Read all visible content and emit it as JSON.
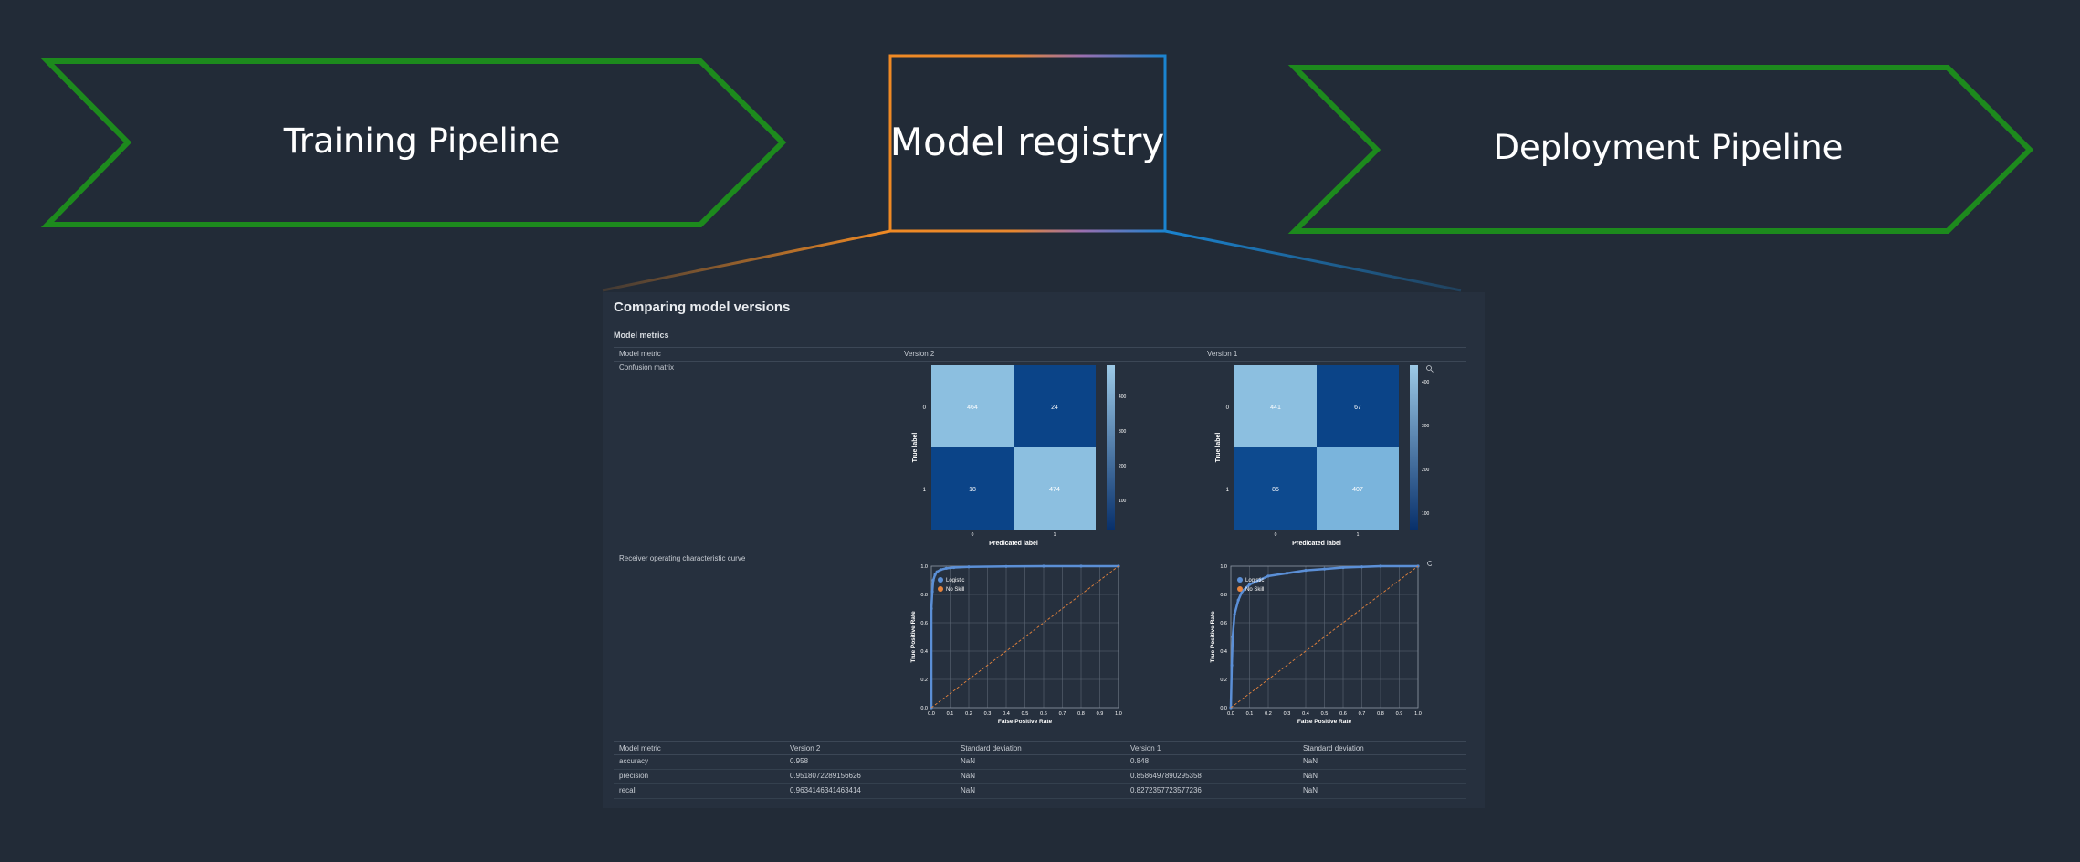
{
  "stages": {
    "training": "Training Pipeline",
    "registry": "Model registry",
    "deployment": "Deployment Pipeline"
  },
  "colors": {
    "background": "#222b37",
    "chevron_stroke": "#1d8a1d",
    "registry_orange": "#f08a24",
    "registry_blue": "#1a84d0",
    "panel": "#26303e",
    "cm_light": "#8cbfe0",
    "cm_dark": "#0b4488",
    "roc_curve": "#5b8fd6",
    "noskill": "#e8843c"
  },
  "panel": {
    "title": "Comparing model versions",
    "section": "Model metrics",
    "headers": [
      "Model metric",
      "Version 2",
      "Version 1"
    ],
    "rows": {
      "confusion": "Confusion matrix",
      "roc": "Receiver operating characteristic curve"
    }
  },
  "confusion_matrices": [
    {
      "version": "Version 2",
      "cells": [
        [
          464,
          24
        ],
        [
          18,
          474
        ]
      ],
      "colorbar_ticks": [
        "400",
        "300",
        "200",
        "100"
      ],
      "ylabel": "True label",
      "xlabel": "Predicated label",
      "row_ticks": [
        "0",
        "1"
      ],
      "col_ticks": [
        "0",
        "1"
      ]
    },
    {
      "version": "Version 1",
      "cells": [
        [
          441,
          67
        ],
        [
          85,
          407
        ]
      ],
      "colorbar_ticks": [
        "400",
        "300",
        "200",
        "100"
      ],
      "ylabel": "True label",
      "xlabel": "Predicated label",
      "row_ticks": [
        "0",
        "1"
      ],
      "col_ticks": [
        "0",
        "1"
      ]
    }
  ],
  "roc": {
    "legend": [
      "Logistic",
      "No Skill"
    ],
    "xlabel": "False Positive Rate",
    "ylabel": "True Positive Rate",
    "x_ticks": [
      "0.0",
      "0.1",
      "0.2",
      "0.3",
      "0.4",
      "0.5",
      "0.6",
      "0.7",
      "0.8",
      "0.9",
      "1.0"
    ],
    "y_ticks": [
      "0.0",
      "0.2",
      "0.4",
      "0.6",
      "0.8",
      "1.0"
    ]
  },
  "chart_data": [
    {
      "type": "line",
      "name": "ROC Version 2",
      "xlabel": "False Positive Rate",
      "ylabel": "True Positive Rate",
      "xlim": [
        0,
        1
      ],
      "ylim": [
        0,
        1
      ],
      "series": [
        {
          "name": "Logistic",
          "x": [
            0,
            0.0,
            0.005,
            0.01,
            0.02,
            0.03,
            0.05,
            0.08,
            0.12,
            0.2,
            0.4,
            0.6,
            0.8,
            1.0
          ],
          "y": [
            0,
            0.7,
            0.82,
            0.9,
            0.94,
            0.96,
            0.975,
            0.985,
            0.99,
            0.995,
            0.998,
            1.0,
            1.0,
            1.0
          ]
        },
        {
          "name": "No Skill",
          "x": [
            0,
            1
          ],
          "y": [
            0,
            1
          ]
        }
      ]
    },
    {
      "type": "line",
      "name": "ROC Version 1",
      "xlabel": "False Positive Rate",
      "ylabel": "True Positive Rate",
      "xlim": [
        0,
        1
      ],
      "ylim": [
        0,
        1
      ],
      "series": [
        {
          "name": "Logistic",
          "x": [
            0,
            0.005,
            0.01,
            0.02,
            0.04,
            0.06,
            0.1,
            0.15,
            0.2,
            0.3,
            0.4,
            0.5,
            0.6,
            0.7,
            0.8,
            1.0
          ],
          "y": [
            0,
            0.3,
            0.5,
            0.66,
            0.76,
            0.82,
            0.87,
            0.9,
            0.93,
            0.95,
            0.97,
            0.98,
            0.99,
            0.995,
            1.0,
            1.0
          ]
        },
        {
          "name": "No Skill",
          "x": [
            0,
            1
          ],
          "y": [
            0,
            1
          ]
        }
      ]
    }
  ],
  "metrics_table": {
    "headers": [
      "Model metric",
      "Version 2",
      "Standard deviation",
      "Version 1",
      "Standard deviation"
    ],
    "rows": [
      [
        "accuracy",
        "0.958",
        "NaN",
        "0.848",
        "NaN"
      ],
      [
        "precision",
        "0.9518072289156626",
        "NaN",
        "0.8586497890295358",
        "NaN"
      ],
      [
        "recall",
        "0.9634146341463414",
        "NaN",
        "0.8272357723577236",
        "NaN"
      ]
    ]
  }
}
